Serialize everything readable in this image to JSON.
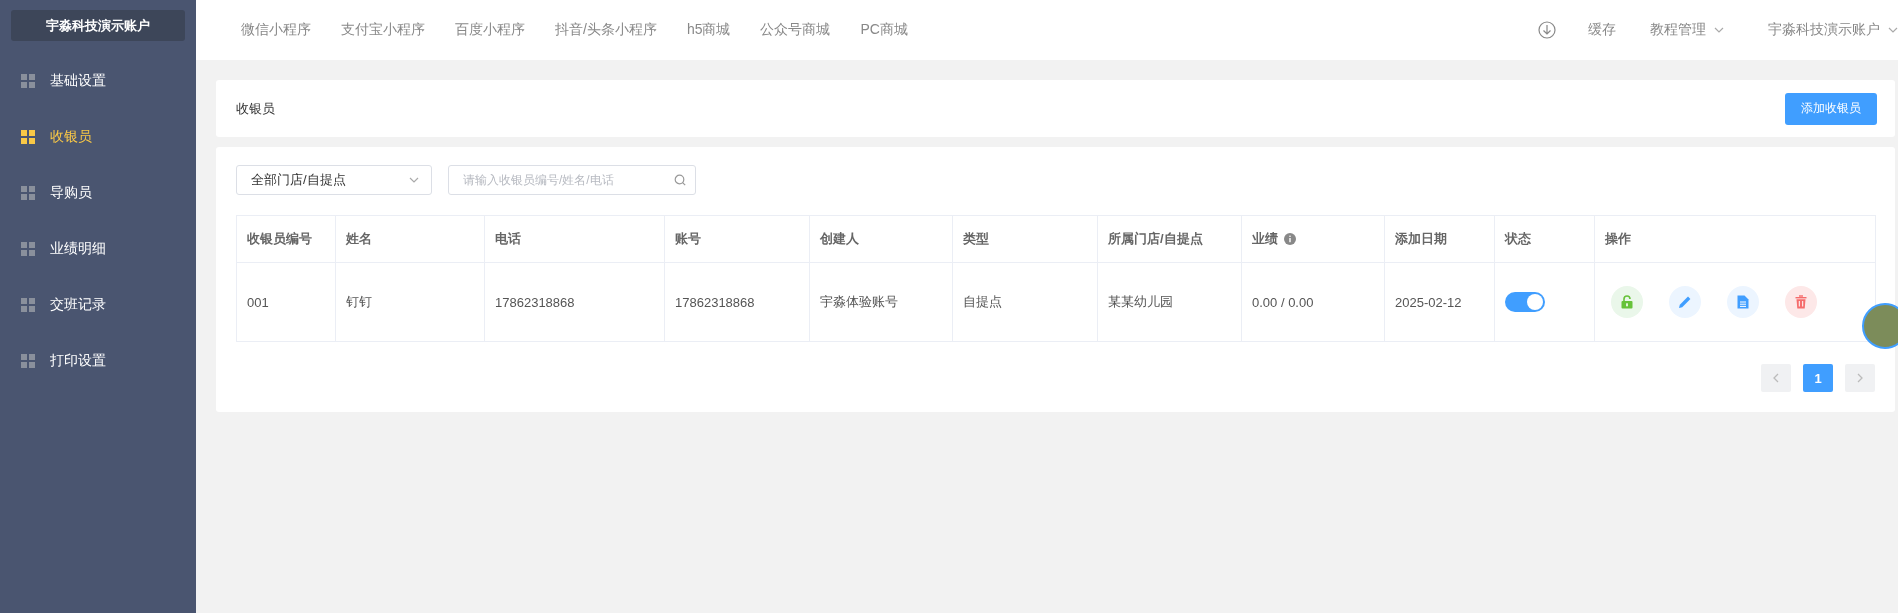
{
  "sidebar": {
    "account": "宇淼科技演示账户",
    "items": [
      {
        "label": "基础设置",
        "selected": false
      },
      {
        "label": "收银员",
        "selected": true
      },
      {
        "label": "导购员",
        "selected": false
      },
      {
        "label": "业绩明细",
        "selected": false
      },
      {
        "label": "交班记录",
        "selected": false
      },
      {
        "label": "打印设置",
        "selected": false
      }
    ]
  },
  "topbar": {
    "links": [
      "微信小程序",
      "支付宝小程序",
      "百度小程序",
      "抖音/头条小程序",
      "h5商城",
      "公众号商城",
      "PC商城"
    ],
    "cache": "缓存",
    "tutorial": "教程管理",
    "account": "宇淼科技演示账户"
  },
  "header": {
    "title": "收银员",
    "add_button": "添加收银员"
  },
  "filters": {
    "store_select": "全部门店/自提点",
    "search": {
      "placeholder": "请输入收银员编号/姓名/电话"
    }
  },
  "table": {
    "columns": [
      {
        "label": "收银员编号",
        "info": false
      },
      {
        "label": "姓名",
        "info": false
      },
      {
        "label": "电话",
        "info": false
      },
      {
        "label": "账号",
        "info": false
      },
      {
        "label": "创建人",
        "info": false
      },
      {
        "label": "类型",
        "info": false
      },
      {
        "label": "所属门店/自提点",
        "info": false
      },
      {
        "label": "业绩",
        "info": true
      },
      {
        "label": "添加日期",
        "info": false
      },
      {
        "label": "状态",
        "info": false
      },
      {
        "label": "操作",
        "info": false
      }
    ],
    "rows": [
      {
        "cells": [
          "001",
          "钉钉",
          "17862318868",
          "17862318868",
          "宇淼体验账号",
          "自提点",
          "某某幼儿园",
          "0.00 / 0.00",
          "2025-02-12"
        ],
        "on": true,
        "actions": [
          {
            "kind": "unlock"
          },
          {
            "kind": "edit"
          },
          {
            "kind": "document"
          },
          {
            "kind": "delete"
          }
        ]
      }
    ]
  },
  "pagination": {
    "pages": [
      {
        "label": "1",
        "selected": true
      }
    ]
  }
}
